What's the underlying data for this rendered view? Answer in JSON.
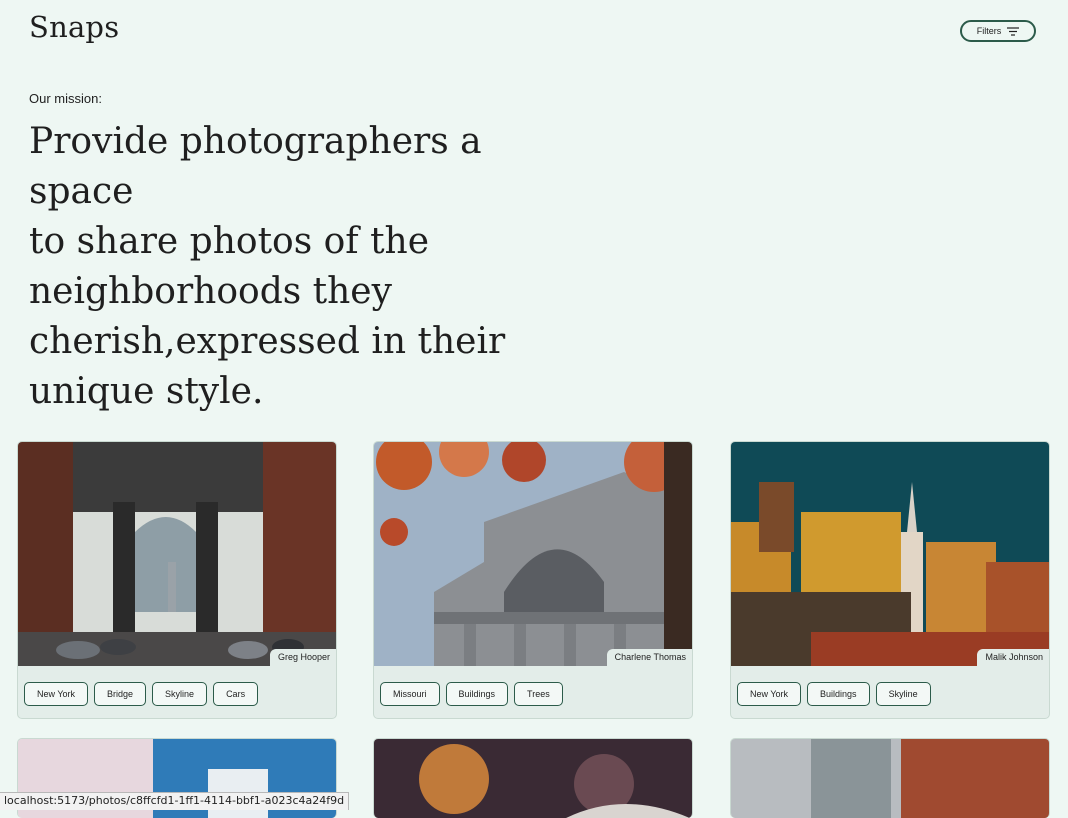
{
  "header": {
    "logo": "Snaps",
    "filters_label": "Filters"
  },
  "mission": {
    "label": "Our mission:",
    "lines": [
      "Provide photographers a space",
      "to share photos of the",
      "neighborhoods they",
      "cherish,expressed in their",
      "unique style."
    ]
  },
  "photos": [
    {
      "author": "Greg Hooper",
      "tags": [
        "New York",
        "Bridge",
        "Skyline",
        "Cars"
      ]
    },
    {
      "author": "Charlene Thomas",
      "tags": [
        "Missouri",
        "Buildings",
        "Trees"
      ]
    },
    {
      "author": "Malik Johnson",
      "tags": [
        "New York",
        "Buildings",
        "Skyline"
      ]
    }
  ],
  "status_bar": {
    "url": "localhost:5173/photos/c8ffcfd1-1ff1-4114-bbf1-a023c4a24f9d"
  },
  "colors": {
    "background": "#eef7f3",
    "accent": "#2c5b4a",
    "card": "#e3ede9"
  }
}
